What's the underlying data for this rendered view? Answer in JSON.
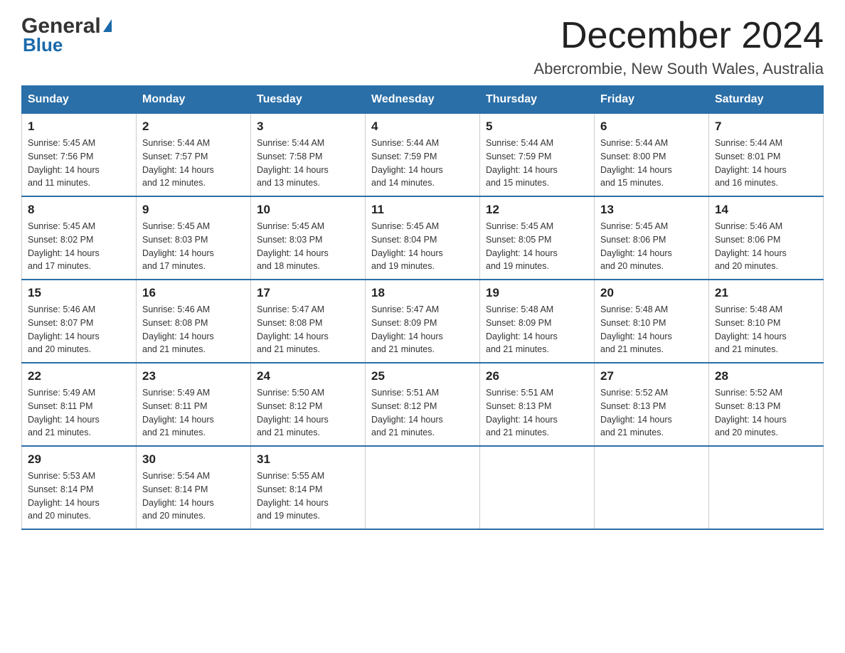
{
  "header": {
    "logo_general": "General",
    "logo_blue": "Blue",
    "month_title": "December 2024",
    "location": "Abercrombie, New South Wales, Australia"
  },
  "weekdays": [
    "Sunday",
    "Monday",
    "Tuesday",
    "Wednesday",
    "Thursday",
    "Friday",
    "Saturday"
  ],
  "weeks": [
    [
      {
        "day": "1",
        "sunrise": "5:45 AM",
        "sunset": "7:56 PM",
        "daylight": "14 hours and 11 minutes."
      },
      {
        "day": "2",
        "sunrise": "5:44 AM",
        "sunset": "7:57 PM",
        "daylight": "14 hours and 12 minutes."
      },
      {
        "day": "3",
        "sunrise": "5:44 AM",
        "sunset": "7:58 PM",
        "daylight": "14 hours and 13 minutes."
      },
      {
        "day": "4",
        "sunrise": "5:44 AM",
        "sunset": "7:59 PM",
        "daylight": "14 hours and 14 minutes."
      },
      {
        "day": "5",
        "sunrise": "5:44 AM",
        "sunset": "7:59 PM",
        "daylight": "14 hours and 15 minutes."
      },
      {
        "day": "6",
        "sunrise": "5:44 AM",
        "sunset": "8:00 PM",
        "daylight": "14 hours and 15 minutes."
      },
      {
        "day": "7",
        "sunrise": "5:44 AM",
        "sunset": "8:01 PM",
        "daylight": "14 hours and 16 minutes."
      }
    ],
    [
      {
        "day": "8",
        "sunrise": "5:45 AM",
        "sunset": "8:02 PM",
        "daylight": "14 hours and 17 minutes."
      },
      {
        "day": "9",
        "sunrise": "5:45 AM",
        "sunset": "8:03 PM",
        "daylight": "14 hours and 17 minutes."
      },
      {
        "day": "10",
        "sunrise": "5:45 AM",
        "sunset": "8:03 PM",
        "daylight": "14 hours and 18 minutes."
      },
      {
        "day": "11",
        "sunrise": "5:45 AM",
        "sunset": "8:04 PM",
        "daylight": "14 hours and 19 minutes."
      },
      {
        "day": "12",
        "sunrise": "5:45 AM",
        "sunset": "8:05 PM",
        "daylight": "14 hours and 19 minutes."
      },
      {
        "day": "13",
        "sunrise": "5:45 AM",
        "sunset": "8:06 PM",
        "daylight": "14 hours and 20 minutes."
      },
      {
        "day": "14",
        "sunrise": "5:46 AM",
        "sunset": "8:06 PM",
        "daylight": "14 hours and 20 minutes."
      }
    ],
    [
      {
        "day": "15",
        "sunrise": "5:46 AM",
        "sunset": "8:07 PM",
        "daylight": "14 hours and 20 minutes."
      },
      {
        "day": "16",
        "sunrise": "5:46 AM",
        "sunset": "8:08 PM",
        "daylight": "14 hours and 21 minutes."
      },
      {
        "day": "17",
        "sunrise": "5:47 AM",
        "sunset": "8:08 PM",
        "daylight": "14 hours and 21 minutes."
      },
      {
        "day": "18",
        "sunrise": "5:47 AM",
        "sunset": "8:09 PM",
        "daylight": "14 hours and 21 minutes."
      },
      {
        "day": "19",
        "sunrise": "5:48 AM",
        "sunset": "8:09 PM",
        "daylight": "14 hours and 21 minutes."
      },
      {
        "day": "20",
        "sunrise": "5:48 AM",
        "sunset": "8:10 PM",
        "daylight": "14 hours and 21 minutes."
      },
      {
        "day": "21",
        "sunrise": "5:48 AM",
        "sunset": "8:10 PM",
        "daylight": "14 hours and 21 minutes."
      }
    ],
    [
      {
        "day": "22",
        "sunrise": "5:49 AM",
        "sunset": "8:11 PM",
        "daylight": "14 hours and 21 minutes."
      },
      {
        "day": "23",
        "sunrise": "5:49 AM",
        "sunset": "8:11 PM",
        "daylight": "14 hours and 21 minutes."
      },
      {
        "day": "24",
        "sunrise": "5:50 AM",
        "sunset": "8:12 PM",
        "daylight": "14 hours and 21 minutes."
      },
      {
        "day": "25",
        "sunrise": "5:51 AM",
        "sunset": "8:12 PM",
        "daylight": "14 hours and 21 minutes."
      },
      {
        "day": "26",
        "sunrise": "5:51 AM",
        "sunset": "8:13 PM",
        "daylight": "14 hours and 21 minutes."
      },
      {
        "day": "27",
        "sunrise": "5:52 AM",
        "sunset": "8:13 PM",
        "daylight": "14 hours and 21 minutes."
      },
      {
        "day": "28",
        "sunrise": "5:52 AM",
        "sunset": "8:13 PM",
        "daylight": "14 hours and 20 minutes."
      }
    ],
    [
      {
        "day": "29",
        "sunrise": "5:53 AM",
        "sunset": "8:14 PM",
        "daylight": "14 hours and 20 minutes."
      },
      {
        "day": "30",
        "sunrise": "5:54 AM",
        "sunset": "8:14 PM",
        "daylight": "14 hours and 20 minutes."
      },
      {
        "day": "31",
        "sunrise": "5:55 AM",
        "sunset": "8:14 PM",
        "daylight": "14 hours and 19 minutes."
      },
      null,
      null,
      null,
      null
    ]
  ],
  "labels": {
    "sunrise": "Sunrise:",
    "sunset": "Sunset:",
    "daylight": "Daylight:"
  }
}
